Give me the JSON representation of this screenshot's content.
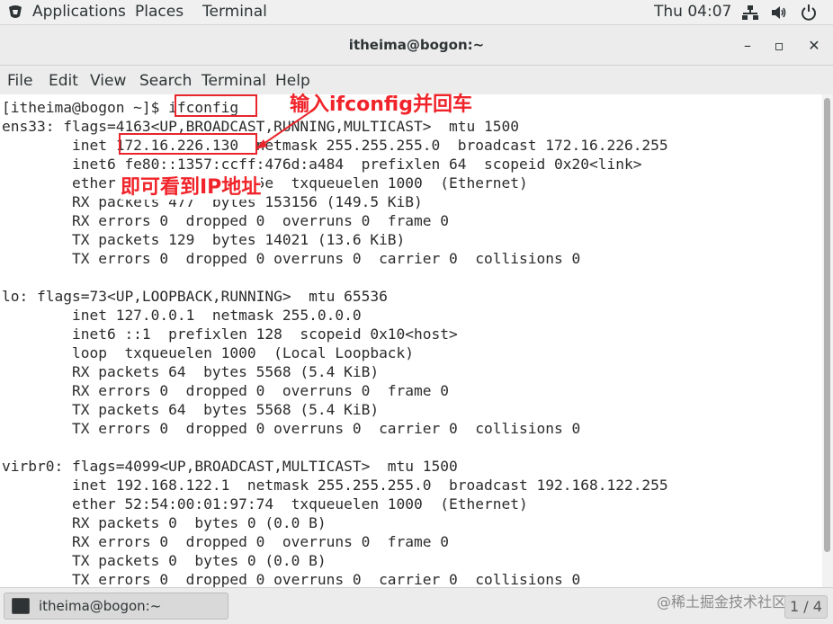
{
  "topbar": {
    "applications": "Applications",
    "places": "Places",
    "terminal": "Terminal",
    "clock": "Thu 04:07"
  },
  "window": {
    "title": "itheima@bogon:~",
    "minimize": "–",
    "maximize": "▫",
    "close": "✕"
  },
  "menubar": [
    "File",
    "Edit",
    "View",
    "Search",
    "Terminal",
    "Help"
  ],
  "terminal": {
    "lines": [
      "[itheima@bogon ~]$ ifconfig",
      "ens33: flags=4163<UP,BROADCAST,RUNNING,MULTICAST>  mtu 1500",
      "        inet 172.16.226.130  netmask 255.255.255.0  broadcast 172.16.226.255",
      "        inet6 fe80::1357:ccff:476d:a484  prefixlen 64  scopeid 0x20<link>",
      "        ether 00:0c:29:a8:4f:5e  txqueuelen 1000  (Ethernet)",
      "        RX packets 477  bytes 153156 (149.5 KiB)",
      "        RX errors 0  dropped 0  overruns 0  frame 0",
      "        TX packets 129  bytes 14021 (13.6 KiB)",
      "        TX errors 0  dropped 0 overruns 0  carrier 0  collisions 0",
      "",
      "lo: flags=73<UP,LOOPBACK,RUNNING>  mtu 65536",
      "        inet 127.0.0.1  netmask 255.0.0.0",
      "        inet6 ::1  prefixlen 128  scopeid 0x10<host>",
      "        loop  txqueuelen 1000  (Local Loopback)",
      "        RX packets 64  bytes 5568 (5.4 KiB)",
      "        RX errors 0  dropped 0  overruns 0  frame 0",
      "        TX packets 64  bytes 5568 (5.4 KiB)",
      "        TX errors 0  dropped 0 overruns 0  carrier 0  collisions 0",
      "",
      "virbr0: flags=4099<UP,BROADCAST,MULTICAST>  mtu 1500",
      "        inet 192.168.122.1  netmask 255.255.255.0  broadcast 192.168.122.255",
      "        ether 52:54:00:01:97:74  txqueuelen 1000  (Ethernet)",
      "        RX packets 0  bytes 0 (0.0 B)",
      "        RX errors 0  dropped 0  overruns 0  frame 0",
      "        TX packets 0  bytes 0 (0.0 B)",
      "        TX errors 0  dropped 0 overruns 0  carrier 0  collisions 0"
    ]
  },
  "annotations": {
    "note1": "输入ifconfig并回车",
    "note2": "即可看到IP地址",
    "color": "#f0242a"
  },
  "taskbar": {
    "task_label": "itheima@bogon:~",
    "watermark": "@稀土掘金技术社区",
    "pager": "1 / 4"
  }
}
